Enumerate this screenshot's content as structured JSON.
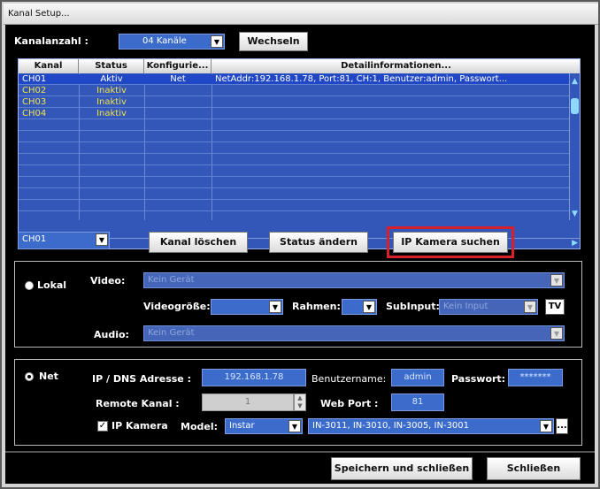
{
  "window": {
    "title": "Kanal Setup..."
  },
  "top": {
    "count_label": "Kanalanzahl :",
    "count_value": "04 Kanäle",
    "change_button": "Wechseln"
  },
  "table": {
    "columns": [
      "Kanal",
      "Status",
      "Konfigurie...",
      "Detailinformationen..."
    ],
    "rows": [
      {
        "kanal": "CH01",
        "status": "Aktiv",
        "config": "Net",
        "details": "NetAddr:192.168.1.78, Port:81, CH:1, Benutzer:admin, Passwort..."
      },
      {
        "kanal": "CH02",
        "status": "Inaktiv",
        "config": "",
        "details": ""
      },
      {
        "kanal": "CH03",
        "status": "Inaktiv",
        "config": "",
        "details": ""
      },
      {
        "kanal": "CH04",
        "status": "Inaktiv",
        "config": "",
        "details": ""
      }
    ]
  },
  "actions": {
    "channel_select": "CH01",
    "delete_button": "Kanal löschen",
    "status_button": "Status ändern",
    "search_button": "IP Kamera suchen"
  },
  "local": {
    "radio_label": "Lokal",
    "video_label": "Video:",
    "video_value": "Kein Gerät",
    "size_label": "Videogröße:",
    "frame_label": "Rahmen:",
    "subinput_label": "SubInput:",
    "subinput_value": "Kein Input",
    "tv_button": "TV",
    "audio_label": "Audio:",
    "audio_value": "Kein Gerät"
  },
  "net": {
    "radio_label": "Net",
    "ip_label": "IP / DNS Adresse :",
    "ip_value": "192.168.1.78",
    "user_label": "Benutzername:",
    "user_value": "admin",
    "password_label": "Passwort:",
    "password_value": "*******",
    "remote_label": "Remote Kanal :",
    "remote_value": "1",
    "port_label": "Web Port :",
    "port_value": "81",
    "ipcam_label": "IP Kamera",
    "model_label": "Model:",
    "model_value": "Instar",
    "model_list": "IN-3011, IN-3010, IN-3005, IN-3001",
    "more_button": "..."
  },
  "footer": {
    "save_button": "Speichern und schließen",
    "close_button": "Schließen"
  },
  "colors": {
    "highlight": "#d8202a",
    "inactive_text": "#f2e24a",
    "selected_row": "#1f47c6"
  }
}
